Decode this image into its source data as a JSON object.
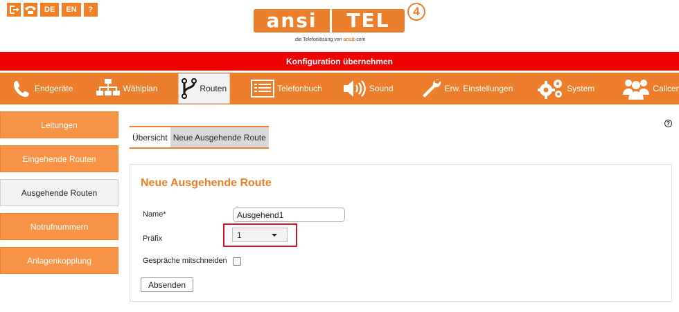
{
  "toolbar": {
    "icons": [
      {
        "name": "logout-icon"
      },
      {
        "name": "phone-icon"
      }
    ],
    "lang_de": "DE",
    "lang_en": "EN",
    "help": "?"
  },
  "logo": {
    "word1": "ansi",
    "word2": "TEL",
    "badge": "4",
    "tagline_prefix": "die Telefonlösung von ",
    "tagline_brand": "ansit",
    "tagline_suffix": "-com"
  },
  "apply_bar": {
    "label": "Konfiguration übernehmen"
  },
  "main_nav": {
    "items": [
      {
        "label": "Endgeräte",
        "icon": "phone-icon"
      },
      {
        "label": "Wählplan",
        "icon": "dialplan-tree-icon"
      },
      {
        "label": "Routen",
        "icon": "routes-fork-icon",
        "active": true
      },
      {
        "label": "Telefonbuch",
        "icon": "phonebook-icon"
      },
      {
        "label": "Sound",
        "icon": "speaker-icon"
      },
      {
        "label": "Erw. Einstellungen",
        "icon": "wrench-icon"
      },
      {
        "label": "System",
        "icon": "gears-icon"
      },
      {
        "label": "Callcenter",
        "icon": "users-icon"
      }
    ]
  },
  "sidebar": {
    "items": [
      {
        "label": "Leitungen"
      },
      {
        "label": "Eingehende Routen"
      },
      {
        "label": "Ausgehende Routen",
        "active": true
      },
      {
        "label": "Notrufnummern"
      },
      {
        "label": "Anlagenkopplung"
      }
    ]
  },
  "help_icon": "?",
  "sub_tabs": {
    "overview": "Übersicht",
    "new_route": "Neue Ausgehende Route"
  },
  "form": {
    "title": "Neue Ausgehende Route",
    "name_label": "Name*",
    "name_value": "Ausgehend1",
    "prefix_label": "Präfix",
    "prefix_value": "1",
    "record_label": "Gespräche mitschneiden",
    "submit_label": "Absenden"
  },
  "colors": {
    "accent": "#ed7f2c",
    "alert": "#ee0000",
    "highlight": "#d9141e"
  }
}
